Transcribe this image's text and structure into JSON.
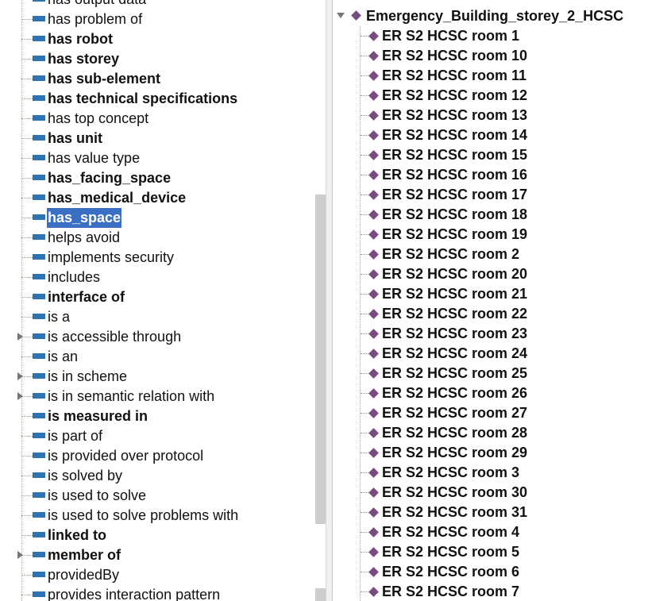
{
  "properties": [
    {
      "label": "has output data",
      "bold": false,
      "expandable": false,
      "selected": false
    },
    {
      "label": "has problem of",
      "bold": false,
      "expandable": false,
      "selected": false
    },
    {
      "label": "has robot",
      "bold": true,
      "expandable": false,
      "selected": false
    },
    {
      "label": "has storey",
      "bold": true,
      "expandable": false,
      "selected": false
    },
    {
      "label": "has sub-element",
      "bold": true,
      "expandable": false,
      "selected": false
    },
    {
      "label": "has technical specifications",
      "bold": true,
      "expandable": false,
      "selected": false
    },
    {
      "label": "has top concept",
      "bold": false,
      "expandable": false,
      "selected": false
    },
    {
      "label": "has unit",
      "bold": true,
      "expandable": false,
      "selected": false
    },
    {
      "label": "has value type",
      "bold": false,
      "expandable": false,
      "selected": false
    },
    {
      "label": "has_facing_space",
      "bold": true,
      "expandable": false,
      "selected": false
    },
    {
      "label": "has_medical_device",
      "bold": true,
      "expandable": false,
      "selected": false
    },
    {
      "label": "has_space",
      "bold": true,
      "expandable": false,
      "selected": true
    },
    {
      "label": "helps avoid",
      "bold": false,
      "expandable": false,
      "selected": false
    },
    {
      "label": "implements security",
      "bold": false,
      "expandable": false,
      "selected": false
    },
    {
      "label": "includes",
      "bold": false,
      "expandable": false,
      "selected": false
    },
    {
      "label": "interface of",
      "bold": true,
      "expandable": false,
      "selected": false
    },
    {
      "label": "is a",
      "bold": false,
      "expandable": false,
      "selected": false
    },
    {
      "label": "is accessible through",
      "bold": false,
      "expandable": true,
      "selected": false
    },
    {
      "label": "is an",
      "bold": false,
      "expandable": false,
      "selected": false
    },
    {
      "label": "is in scheme",
      "bold": false,
      "expandable": true,
      "selected": false
    },
    {
      "label": "is in semantic relation with",
      "bold": false,
      "expandable": true,
      "selected": false
    },
    {
      "label": "is measured in",
      "bold": true,
      "expandable": false,
      "selected": false
    },
    {
      "label": "is part of",
      "bold": false,
      "expandable": false,
      "selected": false
    },
    {
      "label": "is provided over protocol",
      "bold": false,
      "expandable": false,
      "selected": false
    },
    {
      "label": "is solved by",
      "bold": false,
      "expandable": false,
      "selected": false
    },
    {
      "label": "is used to solve",
      "bold": false,
      "expandable": false,
      "selected": false
    },
    {
      "label": "is used to solve problems with",
      "bold": false,
      "expandable": false,
      "selected": false
    },
    {
      "label": "linked to",
      "bold": true,
      "expandable": false,
      "selected": false
    },
    {
      "label": "member of",
      "bold": true,
      "expandable": true,
      "selected": false
    },
    {
      "label": "providedBy",
      "bold": false,
      "expandable": false,
      "selected": false
    },
    {
      "label": "provides interaction pattern",
      "bold": false,
      "expandable": false,
      "selected": false
    }
  ],
  "individuals": {
    "root_label": "Emergency_Building_storey_2_HCSC",
    "items": [
      "ER S2 HCSC room 1",
      "ER S2 HCSC room 10",
      "ER S2 HCSC room 11",
      "ER S2 HCSC room 12",
      "ER S2 HCSC room 13",
      "ER S2 HCSC room 14",
      "ER S2 HCSC room 15",
      "ER S2 HCSC room 16",
      "ER S2 HCSC room 17",
      "ER S2 HCSC room 18",
      "ER S2 HCSC room 19",
      "ER S2 HCSC room 2",
      "ER S2 HCSC room 20",
      "ER S2 HCSC room 21",
      "ER S2 HCSC room 22",
      "ER S2 HCSC room 23",
      "ER S2 HCSC room 24",
      "ER S2 HCSC room 25",
      "ER S2 HCSC room 26",
      "ER S2 HCSC room 27",
      "ER S2 HCSC room 28",
      "ER S2 HCSC room 29",
      "ER S2 HCSC room 3",
      "ER S2 HCSC room 30",
      "ER S2 HCSC room 31",
      "ER S2 HCSC room 4",
      "ER S2 HCSC room 5",
      "ER S2 HCSC room 6",
      "ER S2 HCSC room 7"
    ]
  },
  "colors": {
    "property_bar": "#2e74b5",
    "individual_diamond": "#7a4b82",
    "selection": "#3a6fc4"
  },
  "icons": {
    "property": "object-property-icon",
    "individual": "individual-diamond-icon",
    "collapsed": "expand-arrow-icon",
    "expanded": "collapse-arrow-icon"
  }
}
